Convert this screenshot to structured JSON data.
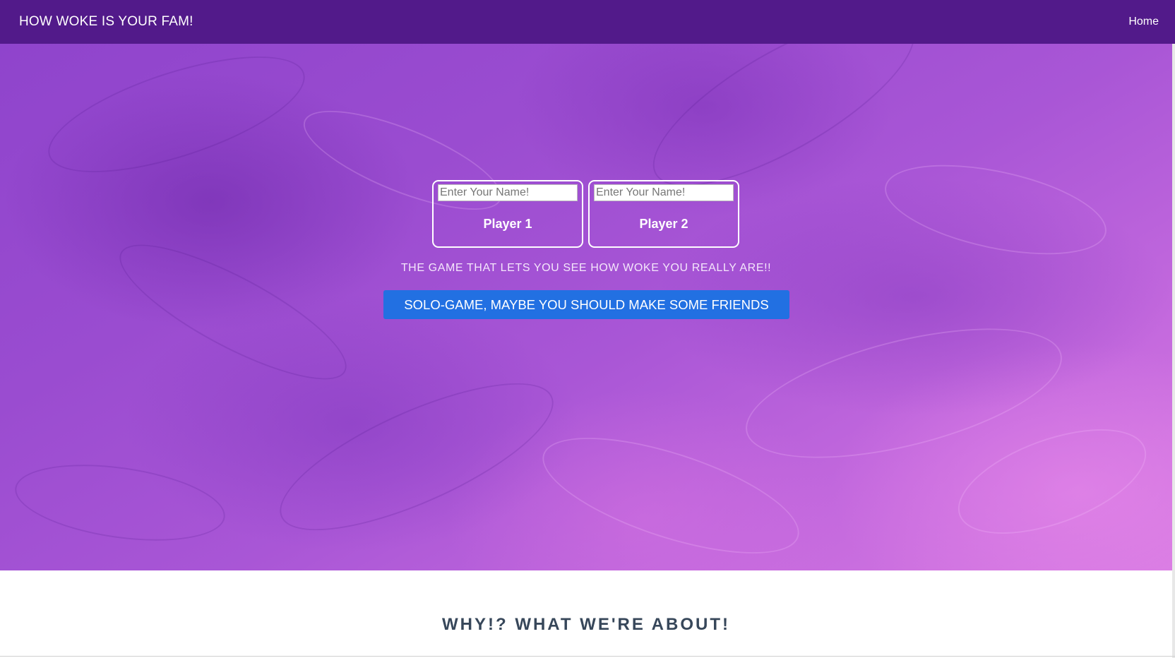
{
  "navbar": {
    "brand": "HOW WOKE IS YOUR FAM!",
    "home_link": "Home",
    "background_color": "#521a8a"
  },
  "hero": {
    "players": [
      {
        "label": "Player 1",
        "name_value": "",
        "name_placeholder": "Enter Your Name!"
      },
      {
        "label": "Player 2",
        "name_value": "",
        "name_placeholder": "Enter Your Name!"
      }
    ],
    "tagline": "THE GAME THAT LETS YOU SEE HOW WOKE YOU REALLY ARE!!",
    "solo_button_label": "SOLO-GAME, MAYBE YOU SHOULD MAKE SOME FRIENDS",
    "solo_button_color": "#2270e2"
  },
  "about": {
    "title": "WHY!? WHAT WE'RE ABOUT!"
  }
}
